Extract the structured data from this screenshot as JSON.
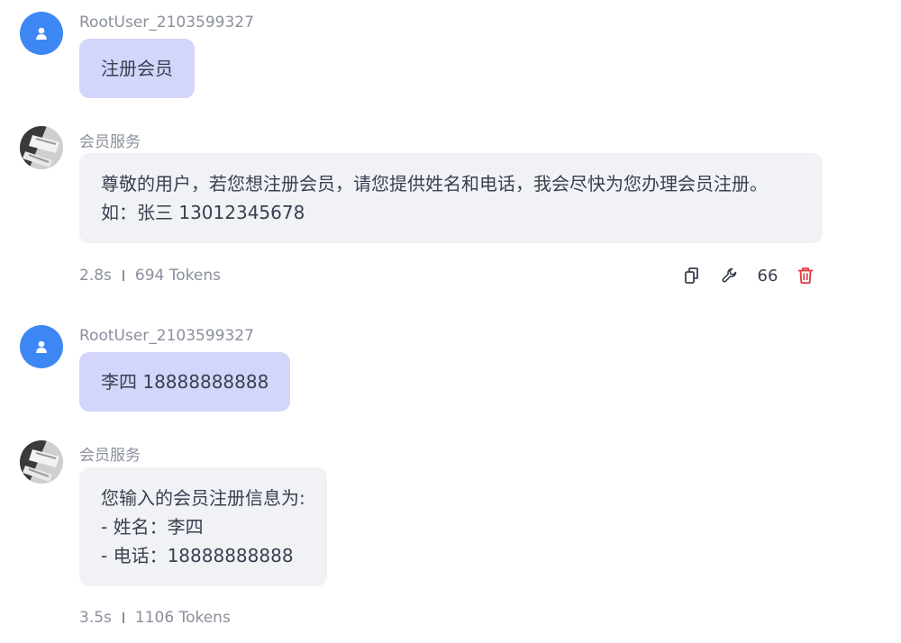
{
  "colors": {
    "user_avatar": "#3d87f5",
    "user_bubble": "#d4d5fb",
    "bot_bubble": "#f1f2f6",
    "delete_icon": "#e0383e"
  },
  "messages": [
    {
      "role": "user",
      "sender": "RootUser_2103599327",
      "lines": [
        "注册会员"
      ],
      "avatar_icon": "person-icon"
    },
    {
      "role": "bot",
      "sender": "会员服务",
      "lines": [
        "尊敬的用户，若您想注册会员，请您提供姓名和电话，我会尽快为您办理会员注册。",
        "如：张三 13012345678"
      ],
      "time": "2.8s",
      "tokens": "694 Tokens",
      "actions": {
        "copy_icon": "copy-icon",
        "wrench_icon": "wrench-icon",
        "quote_label": "66",
        "delete_icon": "trash-icon"
      }
    },
    {
      "role": "user",
      "sender": "RootUser_2103599327",
      "lines": [
        "李四 18888888888"
      ],
      "avatar_icon": "person-icon"
    },
    {
      "role": "bot",
      "sender": "会员服务",
      "lines": [
        "您输入的会员注册信息为:",
        "- 姓名：李四",
        "- 电话：18888888888"
      ],
      "time": "3.5s",
      "tokens": "1106 Tokens"
    }
  ]
}
